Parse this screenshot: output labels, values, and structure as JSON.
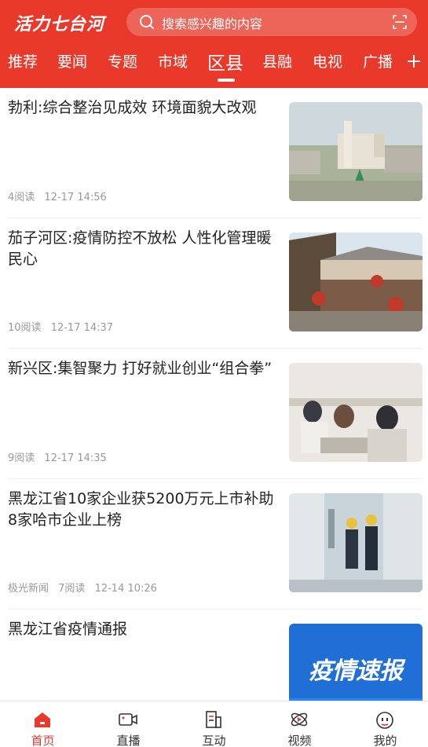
{
  "header": {
    "logo": "活力七台河",
    "search_placeholder": "搜索感兴趣的内容"
  },
  "tabs": [
    {
      "label": "推荐"
    },
    {
      "label": "要闻"
    },
    {
      "label": "专题"
    },
    {
      "label": "市域"
    },
    {
      "label": "区县",
      "active": true
    },
    {
      "label": "县融"
    },
    {
      "label": "电视"
    },
    {
      "label": "广播"
    }
  ],
  "feed": [
    {
      "title": "勃利:综合整治见成效 环境面貌大改观",
      "source": "",
      "reads": "4阅读",
      "time": "12-17 14:56"
    },
    {
      "title": "茄子河区:疫情防控不放松  人性化管理暖民心",
      "source": "",
      "reads": "10阅读",
      "time": "12-17 14:37"
    },
    {
      "title": "新兴区:集智聚力 打好就业创业“组合拳”",
      "source": "",
      "reads": "9阅读",
      "time": "12-17 14:35"
    },
    {
      "title": "黑龙江省10家企业获5200万元上市补助 8家哈市企业上榜",
      "source": "极光新闻",
      "reads": "7阅读",
      "time": "12-14 10:26"
    },
    {
      "title": "黑龙江省疫情通报",
      "source": "",
      "reads": "",
      "time": "",
      "thumb_text": "疫情速报"
    }
  ],
  "bottom_nav": [
    {
      "label": "首页",
      "active": true
    },
    {
      "label": "直播"
    },
    {
      "label": "互动"
    },
    {
      "label": "视频"
    },
    {
      "label": "我的"
    }
  ],
  "colors": {
    "brand": "#e8392b"
  }
}
